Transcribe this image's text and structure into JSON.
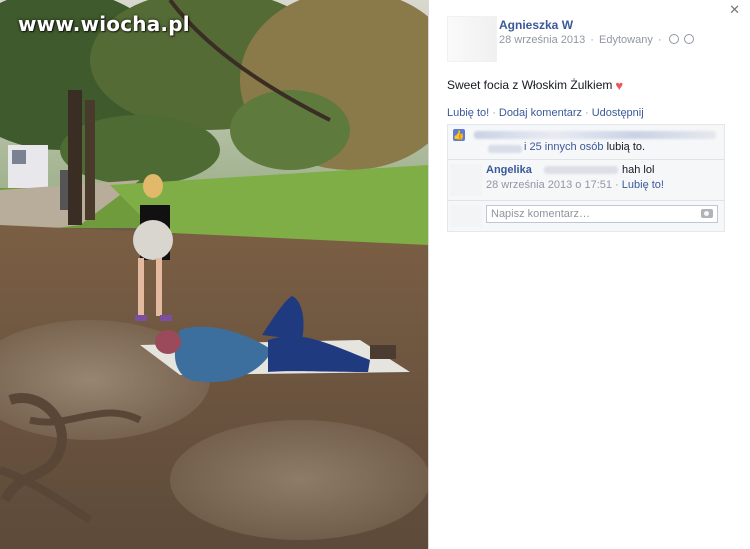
{
  "watermark": "www.wiocha.pl",
  "post": {
    "author": "Agnieszka W",
    "date": "28 września 2013",
    "edited": "Edytowany",
    "text": "Sweet focia z Włoskim Żulkiem",
    "heart_icon": "heart-icon",
    "actions": {
      "like": "Lubię to!",
      "comment": "Dodaj komentarz",
      "share": "Udostępnij"
    },
    "likes": {
      "others_link": "i 25 innych osób",
      "suffix": "lubią to."
    },
    "comments": [
      {
        "author": "Angelika",
        "text": "hah lol",
        "date": "28 września 2013 o 17:51",
        "like": "Lubię to!"
      }
    ],
    "reply_placeholder": "Napisz komentarz…"
  },
  "colors": {
    "link": "#3b5998",
    "meta": "#9197a3",
    "panel_bg": "#f6f7f9",
    "heart": "#e9585c"
  }
}
